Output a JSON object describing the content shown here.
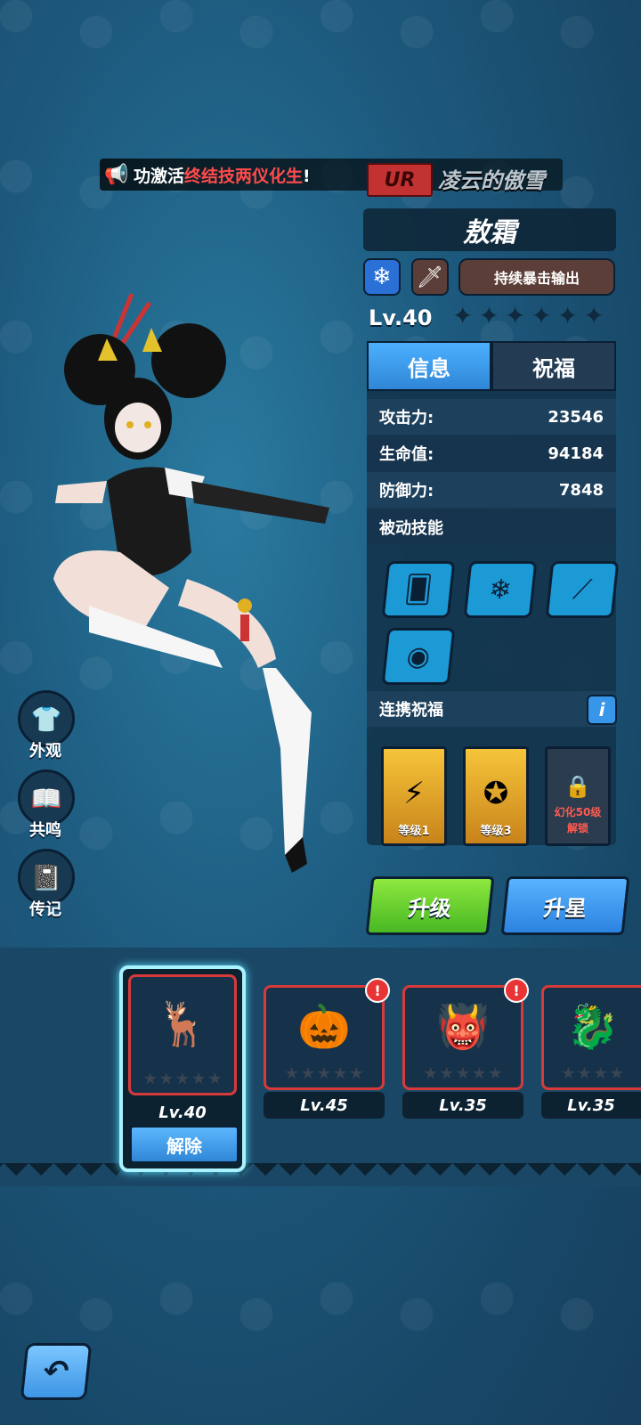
{
  "announcement": {
    "prefix": "功激活",
    "highlight": "终结技两仪化生",
    "suffix": "!"
  },
  "hero": {
    "rarity": "UR",
    "subtitle": "凌云的傲雪",
    "name": "敖霜",
    "tag": "持续暴击输出",
    "level": "Lv.40",
    "element_icon": "snowflake-icon",
    "weapon_icon": "sword-icon"
  },
  "tabs": [
    "信息",
    "祝福"
  ],
  "stats": [
    {
      "label": "攻击力:",
      "value": "23546"
    },
    {
      "label": "生命值:",
      "value": "94184"
    },
    {
      "label": "防御力:",
      "value": "7848"
    }
  ],
  "passive_title": "被动技能",
  "passive_skills": [
    "cards-dice-icon",
    "snowflake-icon",
    "claw-slash-icon",
    "dragon-emblem-icon"
  ],
  "link_bless": {
    "title": "连携祝福",
    "info": "i",
    "cards": [
      {
        "level": "等级1"
      },
      {
        "level": "等级3"
      }
    ],
    "locked": {
      "line1": "幻化50级",
      "line2": "解锁"
    }
  },
  "buttons": {
    "upgrade": "升级",
    "star": "升星"
  },
  "side_menu": [
    {
      "label": "外观",
      "icon": "shirt-icon"
    },
    {
      "label": "共鸣",
      "icon": "book-icon"
    },
    {
      "label": "传记",
      "icon": "journal-icon"
    }
  ],
  "roster": [
    {
      "level": "Lv.40",
      "action": "解除",
      "selected": true
    },
    {
      "level": "Lv.45",
      "alert": "!"
    },
    {
      "level": "Lv.35",
      "alert": "!"
    },
    {
      "level": "Lv.35"
    }
  ],
  "colors": {
    "accent_blue": "#2f86d6",
    "accent_green": "#48b823",
    "alert_red": "#e83434",
    "highlight_red": "#ff4b4b"
  }
}
